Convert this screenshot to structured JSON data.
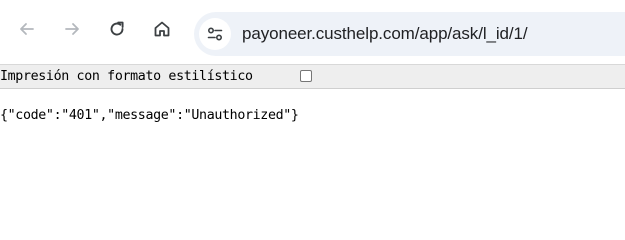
{
  "browser": {
    "url": "payoneer.custhelp.com/app/ask/l_id/1/",
    "nav": {
      "back_icon": "arrow-left-icon",
      "forward_icon": "arrow-right-icon",
      "reload_icon": "reload-icon",
      "home_icon": "home-icon",
      "site_info_icon": "tune-icon"
    }
  },
  "json_viewer": {
    "pretty_print_label": "Impresión con formato estilístico",
    "pretty_print_checked": false,
    "content": "{\"code\":\"401\",\"message\":\"Unauthorized\"}"
  },
  "colors": {
    "omnibox_bg": "#eef2f8",
    "pretty_bar_bg": "#eeeeee",
    "icon_color": "#5f6368",
    "icon_disabled": "#b4b8bd"
  }
}
